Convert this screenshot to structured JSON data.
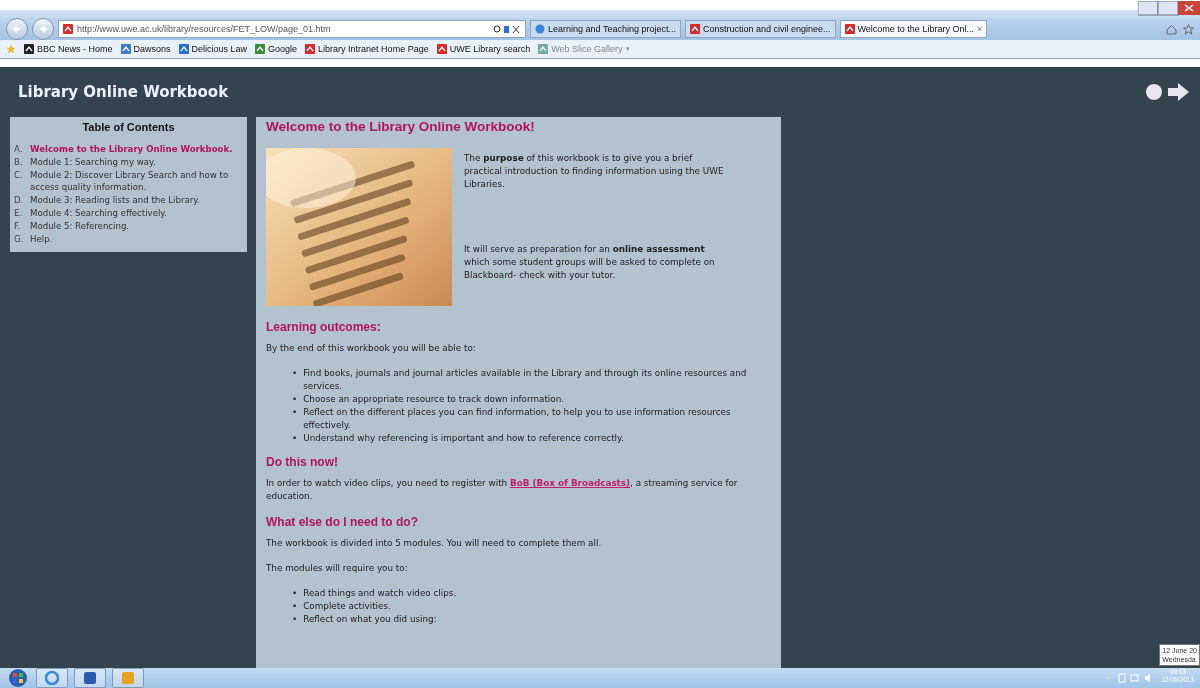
{
  "browser": {
    "address": "http://www.uwe.ac.uk/library/resources/FET_LOW/page_01.htm",
    "tabs": [
      {
        "label": "Learning and Teaching project...",
        "selected": false,
        "kind": "ie"
      },
      {
        "label": "Construction and civil enginee...",
        "selected": false,
        "kind": "uwe"
      },
      {
        "label": "Welcome to the Library Onl...",
        "selected": true,
        "kind": "uwe",
        "close": "×"
      }
    ],
    "favorites": [
      {
        "label": "BBC News - Home",
        "kind": "bbc"
      },
      {
        "label": "Dawsons",
        "kind": "page"
      },
      {
        "label": "Delicious Law",
        "kind": "delicious"
      },
      {
        "label": "Google",
        "kind": "google"
      },
      {
        "label": "Library Intranet Home Page",
        "kind": "uwe"
      },
      {
        "label": "UWE Library search",
        "kind": "uwe"
      },
      {
        "label": "Web Slice Gallery",
        "kind": "slice",
        "menu": "▾"
      }
    ]
  },
  "page": {
    "site_title": "Library Online Workbook",
    "toc": {
      "title": "Table of Contents",
      "items": [
        {
          "letter": "A.",
          "label": "Welcome to the Library Online Workbook.",
          "selected": true
        },
        {
          "letter": "B.",
          "label": "Module 1: Searching my way.",
          "selected": false
        },
        {
          "letter": "C.",
          "label": "Module 2: Discover Library Search and how to access quality information.",
          "selected": false
        },
        {
          "letter": "D.",
          "label": "Module 3: Reading lists and the Library.",
          "selected": false
        },
        {
          "letter": "E.",
          "label": "Module 4: Searching effectively.",
          "selected": false
        },
        {
          "letter": "F.",
          "label": "Module 5: Referencing.",
          "selected": false
        },
        {
          "letter": "G.",
          "label": "Help.",
          "selected": false
        }
      ]
    },
    "heading": "Welcome to the Library Online Workbook!",
    "intro": [
      "The **purpose** of this workbook is to give you a brief practical introduction to finding information using the UWE Libraries.",
      "It will serve as preparation for an **online assessment** which some student groups will be asked to complete on Blackboard- check with your tutor."
    ],
    "blocks": [
      {
        "kind": "heading",
        "text": "Learning outcomes:"
      },
      {
        "kind": "paragraph",
        "text": "By the end of this workbook you will be able to:"
      },
      {
        "kind": "bullets",
        "marker": "•",
        "items": [
          "Find books, journals and journal articles available in the Library and through its online resources and services.",
          "Choose an appropriate resource to track down information.",
          "Reflect on the different places you can find information, to help you to use information resources effectively.",
          "Understand why referencing is important and how to reference correctly."
        ]
      },
      {
        "kind": "heading",
        "text": "Do this now!"
      },
      {
        "kind": "link_paragraph",
        "before": "In order to watch video clips, you need to register with",
        "link": "BoB (Box of Broadcasts)",
        "after": ", a streaming service for education."
      },
      {
        "kind": "heading",
        "text": "What else do I need to do?"
      },
      {
        "kind": "paragraph",
        "text": "The workbook is divided into 5 modules. You will need to complete them all."
      },
      {
        "kind": "paragraph",
        "text": "The modules will require you to:"
      },
      {
        "kind": "bullets",
        "marker": "•",
        "items": [
          "Read things and watch video clips.",
          "Complete activities.",
          "Reflect on what you did using:"
        ]
      }
    ]
  },
  "tooltip": [
    "12 June 20",
    "Wednesda"
  ],
  "taskbar": {
    "apps": [
      {
        "kind": "ie"
      },
      {
        "kind": "word"
      },
      {
        "kind": "outlook"
      }
    ],
    "time": "09:13",
    "date": "12/06/2013"
  }
}
